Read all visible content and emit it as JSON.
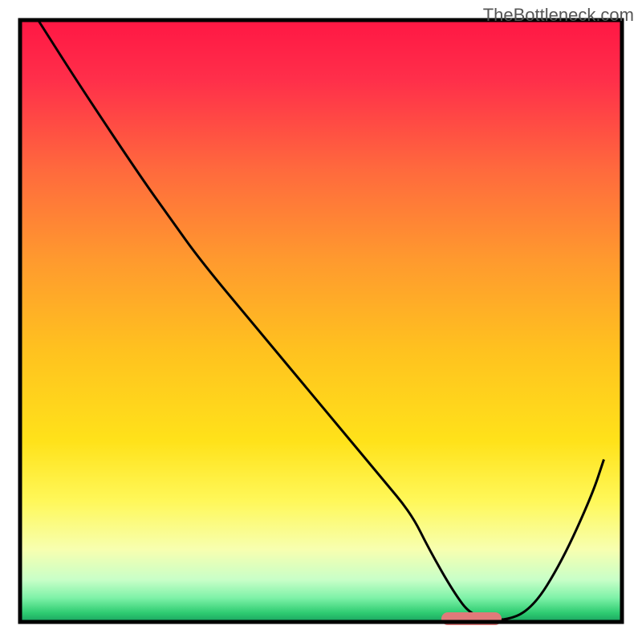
{
  "watermark": "TheBottleneck.com",
  "chart_data": {
    "type": "line",
    "title": "",
    "xlabel": "",
    "ylabel": "",
    "xlim": [
      0,
      100
    ],
    "ylim": [
      0,
      100
    ],
    "x": [
      3,
      10,
      20,
      25,
      30,
      40,
      50,
      60,
      65,
      68,
      72,
      75,
      80,
      85,
      90,
      95,
      97
    ],
    "values": [
      100,
      89,
      74,
      67,
      60,
      48,
      36,
      24,
      18,
      12,
      5,
      1,
      0,
      2,
      10,
      21,
      27
    ],
    "marker": {
      "x_start": 70,
      "x_end": 80,
      "y": 0,
      "color": "#e07a7a"
    },
    "gradient_stops": [
      {
        "offset": 0.0,
        "color": "#ff1744"
      },
      {
        "offset": 0.1,
        "color": "#ff2f4a"
      },
      {
        "offset": 0.25,
        "color": "#ff6a3d"
      },
      {
        "offset": 0.4,
        "color": "#ff9a2e"
      },
      {
        "offset": 0.55,
        "color": "#ffc21f"
      },
      {
        "offset": 0.7,
        "color": "#ffe21a"
      },
      {
        "offset": 0.8,
        "color": "#fff85a"
      },
      {
        "offset": 0.88,
        "color": "#f7ffb0"
      },
      {
        "offset": 0.93,
        "color": "#c8ffc8"
      },
      {
        "offset": 0.96,
        "color": "#7ef2a8"
      },
      {
        "offset": 0.985,
        "color": "#2ecc71"
      },
      {
        "offset": 1.0,
        "color": "#1aa260"
      }
    ]
  }
}
